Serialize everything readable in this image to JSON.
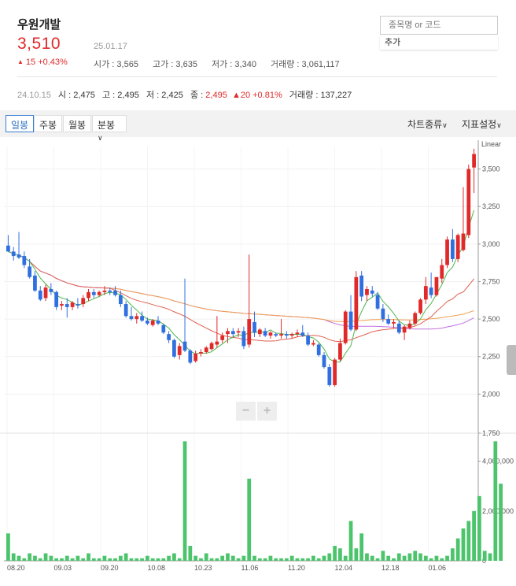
{
  "stock": {
    "name": "우원개발",
    "price": "3,510",
    "date": "25.01.17",
    "change_arrow": "▲",
    "change_text": "15 +0.43%",
    "open": "시가 : 3,565",
    "high": "고가 : 3,635",
    "low": "저가 : 3,340",
    "volume": "거래량 : 3,061,117"
  },
  "search": {
    "placeholder": "종목명 or 코드",
    "add_label": "추가"
  },
  "reference": {
    "date": "24.10.15",
    "open": "시 : 2,475",
    "high": "고 : 2,495",
    "low": "저 : 2,425",
    "close_label": "종 : ",
    "close": "2,495",
    "change": "▲20 +0.81%",
    "volume": "거래량 : 137,227"
  },
  "toolbar": {
    "tabs": [
      "일봉",
      "주봉",
      "월봉",
      "분봉"
    ],
    "active_tab": "일봉",
    "chart_type": "차트종류",
    "indicator": "지표설정"
  },
  "chart_data": {
    "type": "candlestick",
    "scale": "Linear",
    "price_ticks": [
      "3,500",
      "3,250",
      "3,000",
      "2,750",
      "2,500",
      "2,250",
      "2,000",
      "1,750"
    ],
    "volume_ticks": [
      "4,000,000",
      "2,000,000",
      "0"
    ],
    "x_labels": [
      "08.20",
      "09.03",
      "09.20",
      "10.08",
      "10.23",
      "11.06",
      "11.20",
      "12.04",
      "12.18",
      "01.06"
    ],
    "zoom_out": "−",
    "zoom_in": "+",
    "candles": [
      {
        "o": 2990,
        "h": 3060,
        "l": 2950,
        "c": 2950
      },
      {
        "o": 2950,
        "h": 2980,
        "l": 2890,
        "c": 2920
      },
      {
        "o": 2930,
        "h": 3080,
        "l": 2900,
        "c": 2910
      },
      {
        "o": 2920,
        "h": 2950,
        "l": 2840,
        "c": 2860
      },
      {
        "o": 2850,
        "h": 2900,
        "l": 2770,
        "c": 2780
      },
      {
        "o": 2790,
        "h": 2820,
        "l": 2680,
        "c": 2690
      },
      {
        "o": 2690,
        "h": 2720,
        "l": 2620,
        "c": 2630
      },
      {
        "o": 2640,
        "h": 2730,
        "l": 2620,
        "c": 2710
      },
      {
        "o": 2700,
        "h": 2740,
        "l": 2660,
        "c": 2680
      },
      {
        "o": 2680,
        "h": 2690,
        "l": 2560,
        "c": 2580
      },
      {
        "o": 2590,
        "h": 2620,
        "l": 2560,
        "c": 2600
      },
      {
        "o": 2600,
        "h": 2640,
        "l": 2510,
        "c": 2580
      },
      {
        "o": 2580,
        "h": 2620,
        "l": 2560,
        "c": 2610
      },
      {
        "o": 2600,
        "h": 2640,
        "l": 2570,
        "c": 2590
      },
      {
        "o": 2600,
        "h": 2660,
        "l": 2580,
        "c": 2640
      },
      {
        "o": 2640,
        "h": 2700,
        "l": 2620,
        "c": 2680
      },
      {
        "o": 2680,
        "h": 2700,
        "l": 2640,
        "c": 2660
      },
      {
        "o": 2660,
        "h": 2690,
        "l": 2650,
        "c": 2680
      },
      {
        "o": 2680,
        "h": 2720,
        "l": 2660,
        "c": 2690
      },
      {
        "o": 2690,
        "h": 2710,
        "l": 2660,
        "c": 2680
      },
      {
        "o": 2690,
        "h": 2720,
        "l": 2650,
        "c": 2660
      },
      {
        "o": 2660,
        "h": 2690,
        "l": 2580,
        "c": 2600
      },
      {
        "o": 2600,
        "h": 2620,
        "l": 2510,
        "c": 2520
      },
      {
        "o": 2520,
        "h": 2580,
        "l": 2490,
        "c": 2500
      },
      {
        "o": 2500,
        "h": 2540,
        "l": 2470,
        "c": 2520
      },
      {
        "o": 2520,
        "h": 2550,
        "l": 2480,
        "c": 2490
      },
      {
        "o": 2490,
        "h": 2510,
        "l": 2460,
        "c": 2470
      },
      {
        "o": 2460,
        "h": 2500,
        "l": 2450,
        "c": 2490
      },
      {
        "o": 2490,
        "h": 2520,
        "l": 2460,
        "c": 2470
      },
      {
        "o": 2460,
        "h": 2470,
        "l": 2400,
        "c": 2410
      },
      {
        "o": 2400,
        "h": 2420,
        "l": 2340,
        "c": 2360
      },
      {
        "o": 2360,
        "h": 2370,
        "l": 2240,
        "c": 2250
      },
      {
        "o": 2260,
        "h": 2340,
        "l": 2230,
        "c": 2320
      },
      {
        "o": 2350,
        "h": 2770,
        "l": 2280,
        "c": 2290
      },
      {
        "o": 2290,
        "h": 2300,
        "l": 2200,
        "c": 2210
      },
      {
        "o": 2220,
        "h": 2290,
        "l": 2210,
        "c": 2270
      },
      {
        "o": 2270,
        "h": 2300,
        "l": 2250,
        "c": 2280
      },
      {
        "o": 2280,
        "h": 2320,
        "l": 2270,
        "c": 2310
      },
      {
        "o": 2300,
        "h": 2350,
        "l": 2290,
        "c": 2340
      },
      {
        "o": 2330,
        "h": 2520,
        "l": 2310,
        "c": 2350
      },
      {
        "o": 2360,
        "h": 2410,
        "l": 2340,
        "c": 2390
      },
      {
        "o": 2400,
        "h": 2440,
        "l": 2340,
        "c": 2420
      },
      {
        "o": 2420,
        "h": 2440,
        "l": 2380,
        "c": 2400
      },
      {
        "o": 2410,
        "h": 2440,
        "l": 2380,
        "c": 2420
      },
      {
        "o": 2420,
        "h": 2450,
        "l": 2300,
        "c": 2320
      },
      {
        "o": 2330,
        "h": 2930,
        "l": 2310,
        "c": 2500
      },
      {
        "o": 2480,
        "h": 2550,
        "l": 2380,
        "c": 2410
      },
      {
        "o": 2400,
        "h": 2440,
        "l": 2380,
        "c": 2430
      },
      {
        "o": 2420,
        "h": 2440,
        "l": 2380,
        "c": 2390
      },
      {
        "o": 2390,
        "h": 2420,
        "l": 2370,
        "c": 2410
      },
      {
        "o": 2400,
        "h": 2410,
        "l": 2380,
        "c": 2390
      },
      {
        "o": 2390,
        "h": 2500,
        "l": 2370,
        "c": 2400
      },
      {
        "o": 2400,
        "h": 2420,
        "l": 2370,
        "c": 2390
      },
      {
        "o": 2390,
        "h": 2410,
        "l": 2370,
        "c": 2400
      },
      {
        "o": 2400,
        "h": 2430,
        "l": 2380,
        "c": 2410
      },
      {
        "o": 2410,
        "h": 2460,
        "l": 2380,
        "c": 2390
      },
      {
        "o": 2390,
        "h": 2410,
        "l": 2320,
        "c": 2330
      },
      {
        "o": 2330,
        "h": 2360,
        "l": 2320,
        "c": 2340
      },
      {
        "o": 2330,
        "h": 2340,
        "l": 2250,
        "c": 2260
      },
      {
        "o": 2260,
        "h": 2280,
        "l": 2170,
        "c": 2180
      },
      {
        "o": 2180,
        "h": 2200,
        "l": 2050,
        "c": 2060
      },
      {
        "o": 2060,
        "h": 2240,
        "l": 2050,
        "c": 2230
      },
      {
        "o": 2230,
        "h": 2370,
        "l": 2220,
        "c": 2340
      },
      {
        "o": 2340,
        "h": 2560,
        "l": 2330,
        "c": 2550
      },
      {
        "o": 2550,
        "h": 2660,
        "l": 2420,
        "c": 2430
      },
      {
        "o": 2430,
        "h": 2820,
        "l": 2420,
        "c": 2780
      },
      {
        "o": 2790,
        "h": 2820,
        "l": 2620,
        "c": 2650
      },
      {
        "o": 2660,
        "h": 2720,
        "l": 2620,
        "c": 2700
      },
      {
        "o": 2690,
        "h": 2720,
        "l": 2650,
        "c": 2670
      },
      {
        "o": 2660,
        "h": 2680,
        "l": 2560,
        "c": 2570
      },
      {
        "o": 2570,
        "h": 2600,
        "l": 2480,
        "c": 2500
      },
      {
        "o": 2500,
        "h": 2530,
        "l": 2460,
        "c": 2470
      },
      {
        "o": 2470,
        "h": 2500,
        "l": 2440,
        "c": 2480
      },
      {
        "o": 2470,
        "h": 2490,
        "l": 2400,
        "c": 2410
      },
      {
        "o": 2410,
        "h": 2460,
        "l": 2360,
        "c": 2450
      },
      {
        "o": 2440,
        "h": 2490,
        "l": 2430,
        "c": 2470
      },
      {
        "o": 2470,
        "h": 2550,
        "l": 2460,
        "c": 2540
      },
      {
        "o": 2540,
        "h": 2640,
        "l": 2530,
        "c": 2630
      },
      {
        "o": 2630,
        "h": 2780,
        "l": 2600,
        "c": 2720
      },
      {
        "o": 2710,
        "h": 2810,
        "l": 2640,
        "c": 2660
      },
      {
        "o": 2660,
        "h": 2780,
        "l": 2650,
        "c": 2780
      },
      {
        "o": 2770,
        "h": 2900,
        "l": 2740,
        "c": 2860
      },
      {
        "o": 2860,
        "h": 3050,
        "l": 2840,
        "c": 3030
      },
      {
        "o": 3030,
        "h": 3100,
        "l": 2880,
        "c": 2900
      },
      {
        "o": 2900,
        "h": 3070,
        "l": 2880,
        "c": 3060
      },
      {
        "o": 2960,
        "h": 3380,
        "l": 2950,
        "c": 3070
      },
      {
        "o": 3060,
        "h": 3530,
        "l": 3040,
        "c": 3500
      },
      {
        "o": 3510,
        "h": 3635,
        "l": 3340,
        "c": 3600
      }
    ],
    "volumes": [
      1.1,
      0.3,
      0.2,
      0.1,
      0.3,
      0.2,
      0.1,
      0.3,
      0.2,
      0.1,
      0.1,
      0.2,
      0.1,
      0.2,
      0.1,
      0.3,
      0.1,
      0.1,
      0.2,
      0.1,
      0.1,
      0.2,
      0.3,
      0.1,
      0.1,
      0.1,
      0.2,
      0.1,
      0.1,
      0.1,
      0.2,
      0.3,
      0.1,
      4.8,
      0.6,
      0.2,
      0.1,
      0.3,
      0.1,
      0.1,
      0.2,
      0.3,
      0.2,
      0.1,
      0.2,
      3.3,
      0.2,
      0.1,
      0.1,
      0.2,
      0.1,
      0.1,
      0.1,
      0.2,
      0.1,
      0.1,
      0.1,
      0.2,
      0.1,
      0.2,
      0.3,
      0.6,
      0.5,
      0.2,
      1.6,
      0.5,
      1.1,
      0.3,
      0.2,
      0.1,
      0.4,
      0.2,
      0.1,
      0.3,
      0.2,
      0.3,
      0.4,
      0.3,
      0.2,
      0.1,
      0.2,
      0.1,
      0.2,
      0.5,
      0.9,
      1.3,
      1.6,
      2.0,
      2.6,
      0.4,
      0.3,
      4.8,
      3.1
    ],
    "price_min": 1750,
    "price_max": 3650,
    "volume_max": 5000000,
    "colors": {
      "up": "#e02a2a",
      "down": "#2f6fe0",
      "ma5": "#4cb84c",
      "ma20": "#e06050",
      "ma60": "#c070e0",
      "ma120": "#f0a050",
      "volume": "#4cc46c"
    }
  }
}
